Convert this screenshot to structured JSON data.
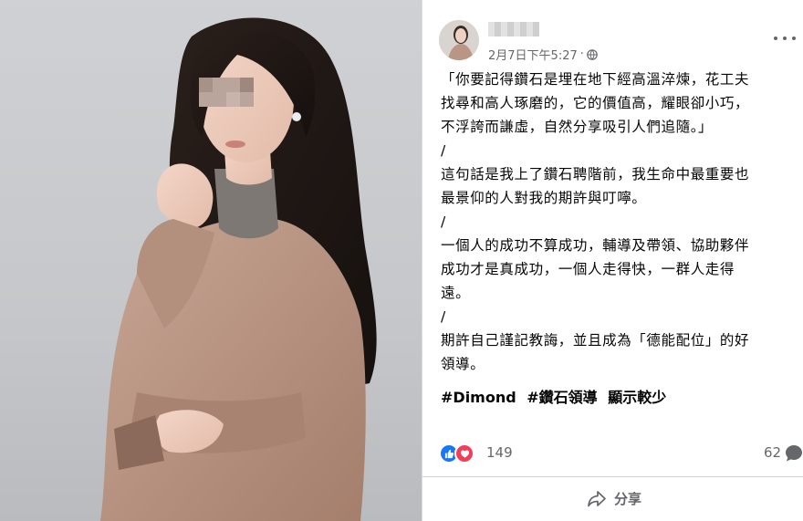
{
  "post": {
    "timestamp": "2月7日下午5:27",
    "separator": "·",
    "privacy_icon": "globe-icon",
    "menu_icon": "more-options-icon",
    "paragraphs": [
      "「你要記得鑽石是埋在地下經高溫淬煉，花工夫\n找尋和高人琢磨的，它的價值高，耀眼卻小巧，\n不浮誇而謙虛，自然分享吸引人們追隨。」",
      "/",
      "這句話是我上了鑽石聘階前，我生命中最重要也\n最景仰的人對我的期許與叮嚀。",
      "/",
      "一個人的成功不算成功，輔導及帶領、協助夥伴\n成功才是真成功，一個人走得快，一群人走得\n遠。",
      "/",
      "期許自己謹記教誨，並且成為「德能配位」的好\n領導。"
    ],
    "hashtags": [
      "#Dimond",
      "#鑽石領導"
    ],
    "see_less": "顯示較少",
    "reaction_count": "149",
    "comment_count": "62",
    "share_label": "分享"
  },
  "colors": {
    "like_blue": "#1877f2",
    "love_red": "#f33e58",
    "secondary_text": "#65676b",
    "jacket": "#b89584"
  }
}
